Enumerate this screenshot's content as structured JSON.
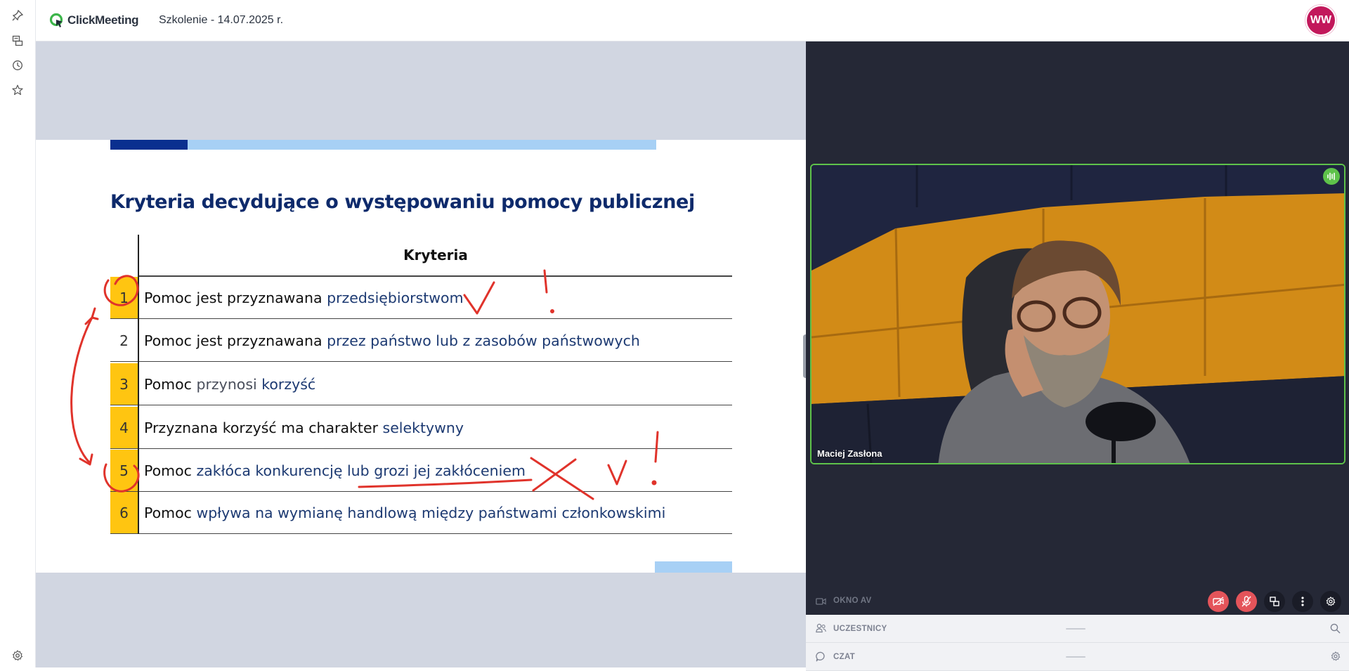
{
  "app": {
    "logo_text": "ClickMeeting",
    "meeting_title": "Szkolenie - 14.07.2025 r.",
    "user_initials": "WW"
  },
  "rail": {
    "icons": [
      "pin-icon",
      "presentation-icon",
      "history-icon",
      "star-icon"
    ],
    "bottom_icon": "settings-icon"
  },
  "slide": {
    "title": "Kryteria decydujące o występowaniu pomocy publicznej",
    "table_header": "Kryteria",
    "rows": [
      {
        "num": "1",
        "parts": [
          {
            "t": "Pomoc jest przyznawana ",
            "c": "a"
          },
          {
            "t": "przedsiębiorstwom",
            "c": "b"
          }
        ],
        "highlight": true
      },
      {
        "num": "2",
        "parts": [
          {
            "t": "Pomoc jest przyznawana ",
            "c": "a"
          },
          {
            "t": "przez państwo lub z zasobów państwowych",
            "c": "b"
          }
        ],
        "highlight": false
      },
      {
        "num": "3",
        "parts": [
          {
            "t": "Pomoc ",
            "c": "a"
          },
          {
            "t": "przynosi ",
            "c": "g"
          },
          {
            "t": "korzyść",
            "c": "b"
          }
        ],
        "highlight": true
      },
      {
        "num": "4",
        "parts": [
          {
            "t": "Przyznana korzyść ma charakter ",
            "c": "a"
          },
          {
            "t": "selektywny",
            "c": "b"
          }
        ],
        "highlight": true
      },
      {
        "num": "5",
        "parts": [
          {
            "t": "Pomoc ",
            "c": "a"
          },
          {
            "t": "zakłóca konkurencję lub grozi jej zakłóceniem",
            "c": "b"
          }
        ],
        "highlight": true
      },
      {
        "num": "6",
        "parts": [
          {
            "t": "Pomoc ",
            "c": "a"
          },
          {
            "t": "wpływa na wymianę handlową między państwami członkowskimi",
            "c": "b"
          }
        ],
        "highlight": true
      }
    ]
  },
  "video": {
    "speaker_name": "Maciej Zasłona"
  },
  "av": {
    "label": "OKNO AV",
    "controls": [
      "camera-off-icon",
      "mic-off-icon",
      "layout-icon",
      "more-icon",
      "settings-icon"
    ]
  },
  "sections": {
    "participants": "UCZESTNICY",
    "chat": "CZAT"
  },
  "colors": {
    "accent_green": "#5ec24a",
    "avatar": "#c2185b",
    "slide_navy": "#0e2a6b",
    "slide_yellow": "#ffc511",
    "ink_red": "#e0332b",
    "control_red": "#e4545a"
  }
}
